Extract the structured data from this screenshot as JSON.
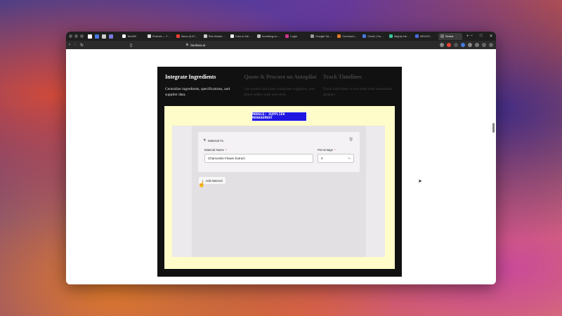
{
  "browser": {
    "tabs": [
      {
        "label": "Tech50",
        "color": "#ffffff"
      },
      {
        "label": "Portrait — Y…",
        "color": "#dddddd"
      },
      {
        "label": "Inbox (4,47…",
        "color": "#e94235"
      },
      {
        "label": "Ree Marke…",
        "color": "#cccccc"
      },
      {
        "label": "Intro to Ne…",
        "color": "#eeeeee"
      },
      {
        "label": "Investing.co…",
        "color": "#bbbbbb"
      },
      {
        "label": "Login",
        "color": "#d0348a"
      },
      {
        "label": "Google Sa…",
        "color": "#999999"
      },
      {
        "label": "Communi…",
        "color": "#e07a2a"
      },
      {
        "label": "Circle | Ho…",
        "color": "#4a7ae0"
      },
      {
        "label": "Mighty Ne…",
        "color": "#3ac09a"
      },
      {
        "label": "NEXUS…",
        "color": "#4a6ae0"
      },
      {
        "label": "Senka",
        "color": "#777777"
      }
    ],
    "url": "benkara.ai"
  },
  "steps": [
    {
      "title": "Integrate Ingredients",
      "desc": "Centralize ingredients, specifications, and supplier data."
    },
    {
      "title": "Quote & Procure on Autopilot",
      "desc": "Get quotes fast from compliant suppliers, and place orders with one click."
    },
    {
      "title": "Track Timelines",
      "desc": "Track lead times in real time with automated updates."
    }
  ],
  "module_badge": "MODULE: SUPPLIER MANAGEMENT",
  "material_card": {
    "title": "Material #1",
    "name_label": "Material Name",
    "name_value": "Chamomile Flower Extract",
    "pct_label": "Percentage",
    "pct_value": "0",
    "pct_suffix": "%",
    "required_mark": "*"
  },
  "add_material_label": "Add Material",
  "icons": {
    "material": "flask-icon",
    "delete": "trash-icon",
    "add": "plus-icon"
  }
}
